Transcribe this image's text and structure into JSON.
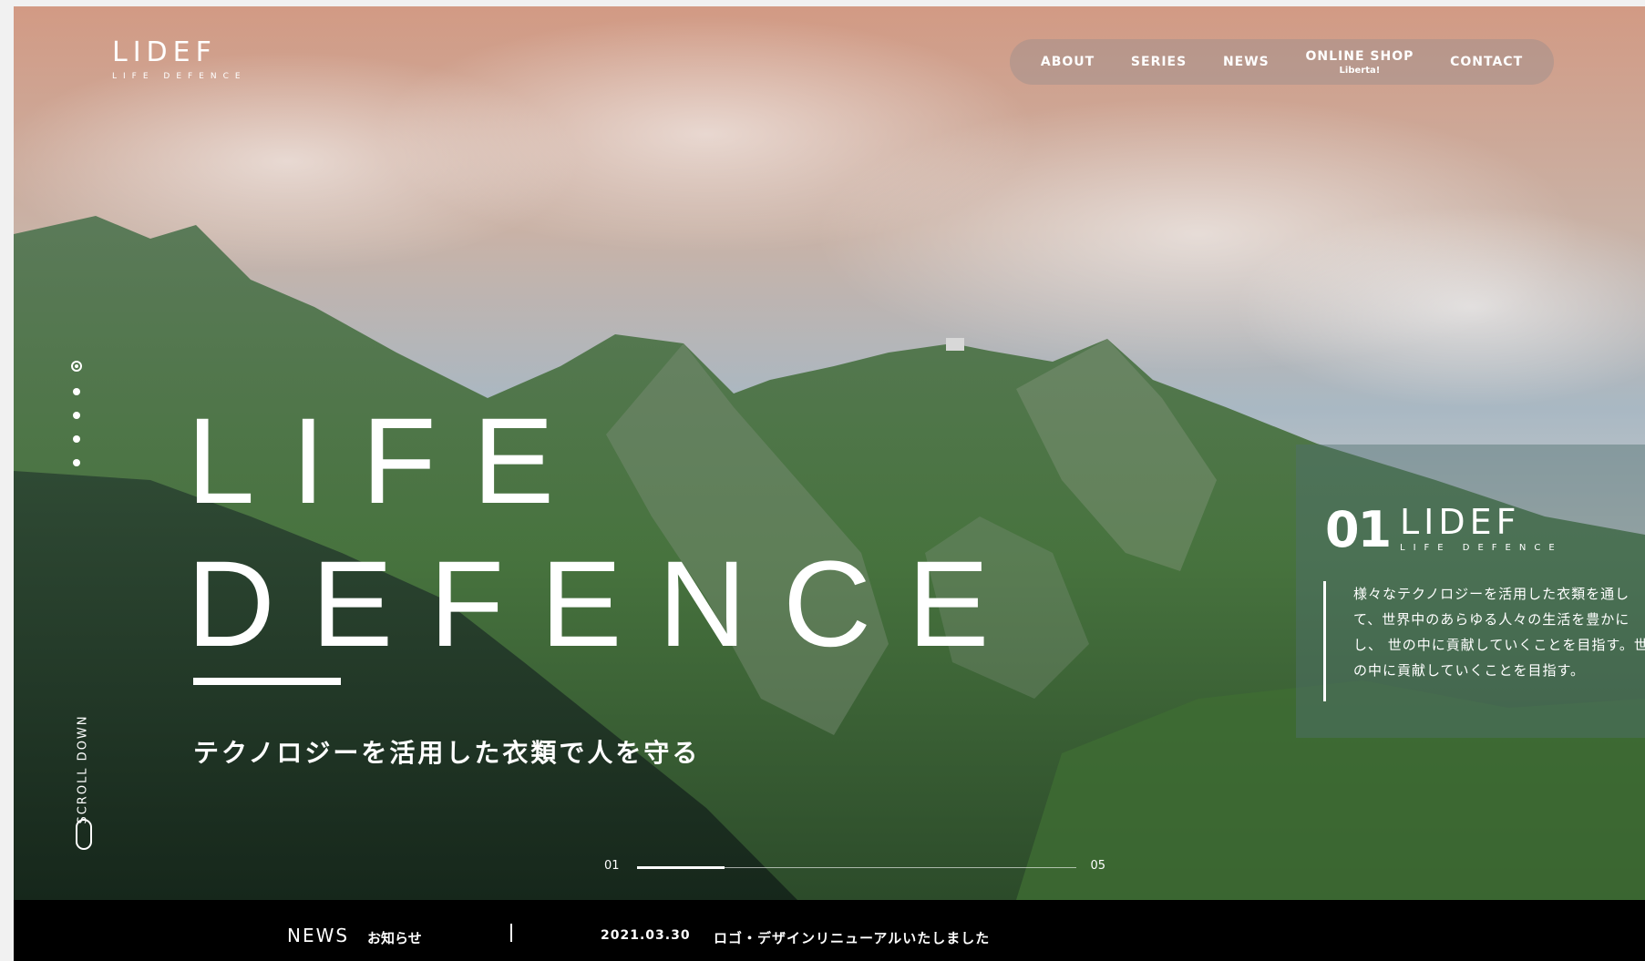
{
  "brand": {
    "logo": "LIDEF",
    "logo_sub": "LIFE DEFENCE"
  },
  "nav": {
    "items": [
      {
        "label": "ABOUT"
      },
      {
        "label": "SERIES"
      },
      {
        "label": "NEWS"
      },
      {
        "label": "ONLINE SHOP",
        "sub": "Liberta!"
      },
      {
        "label": "CONTACT"
      }
    ]
  },
  "hero": {
    "title_line1": "LIFE",
    "title_line2": "DEFENCE",
    "tagline": "テクノロジーを活用した衣類で人を守る",
    "scroll_label": "SCROLL DOWN",
    "slides_total": 5,
    "slide_current": 1,
    "progress_start": "01",
    "progress_end": "05"
  },
  "panel": {
    "number": "01",
    "logo": "LIDEF",
    "logo_sub": "LIFE DEFENCE",
    "text": "様々なテクノロジーを活用した衣類を通して、世界中のあらゆる人々の生活を豊かにし、 世の中に貢献していくことを目指す。世の中に貢献していくことを目指す。"
  },
  "news": {
    "label": "NEWS",
    "sub": "お知らせ",
    "date": "2021.03.30",
    "title": "ロゴ・デザインリニューアルいたしました"
  },
  "colors": {
    "news_bar": "#000000",
    "text": "#ffffff",
    "sky_top": "#d8a58d",
    "mountain": "#3f6a3a"
  }
}
